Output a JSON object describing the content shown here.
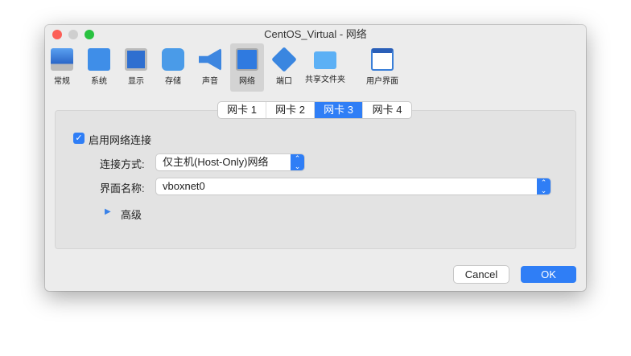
{
  "window": {
    "title": "CentOS_Virtual - 网络"
  },
  "toolbar": {
    "items": [
      {
        "label": "常规",
        "icon": "general-icon"
      },
      {
        "label": "系统",
        "icon": "system-chip-icon"
      },
      {
        "label": "显示",
        "icon": "display-monitor-icon"
      },
      {
        "label": "存储",
        "icon": "storage-disk-icon"
      },
      {
        "label": "声音",
        "icon": "audio-speaker-icon"
      },
      {
        "label": "网络",
        "icon": "network-icon",
        "selected": true
      },
      {
        "label": "端口",
        "icon": "serial-port-icon"
      },
      {
        "label": "共享文件夹",
        "icon": "shared-folder-icon"
      },
      {
        "label": "用户界面",
        "icon": "user-interface-icon"
      }
    ]
  },
  "tabs": [
    "网卡 1",
    "网卡 2",
    "网卡 3",
    "网卡 4"
  ],
  "selected_tab": "网卡 3",
  "form": {
    "enable_label": "启用网络连接",
    "enable_checked": true,
    "attached_label": "连接方式:",
    "attached_value": "仅主机(Host-Only)网络",
    "name_label": "界面名称:",
    "name_value": "vboxnet0",
    "advanced_label": "高级"
  },
  "buttons": {
    "cancel": "Cancel",
    "ok": "OK"
  },
  "colors": {
    "accent": "#2f7ef6"
  }
}
